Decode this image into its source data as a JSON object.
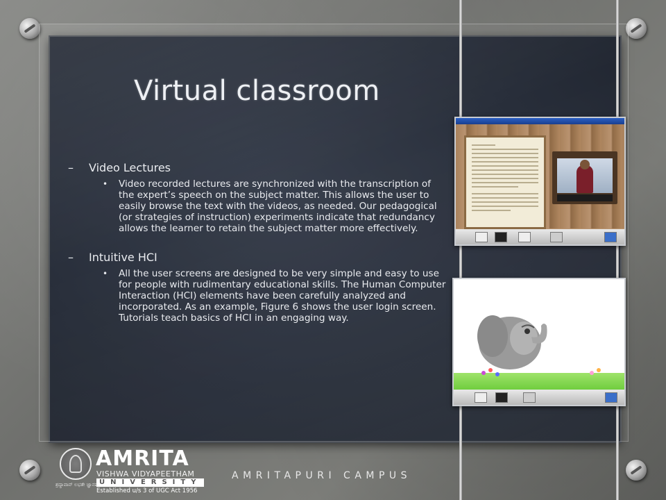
{
  "slide": {
    "title": "Virtual classroom",
    "sections": [
      {
        "heading": "Video Lectures",
        "body": "Video recorded lectures are synchronized with the transcription of the expert’s speech on the subject matter. This allows the user to easily browse the text with the videos, as needed. Our pedagogical (or strategies of instruction) experiments indicate that redundancy allows the learner to retain the subject matter more effectively."
      },
      {
        "heading": "Intuitive HCI",
        "body": "All the user screens are designed to be very simple and easy to use for people with rudimentary educational skills. The Human Computer Interaction (HCI) elements have been carefully analyzed and incorporated. As an example, Figure 6 shows the user login screen. Tutorials teach basics of HCI in an engaging way."
      }
    ]
  },
  "footer": {
    "brand": "AMRITA",
    "brand_sub": "VISHWA VIDYAPEETHAM",
    "brand_univ": "UNIVERSITY",
    "brand_est": "Established u/s 3 of UGC Act 1956",
    "emblem_caption": "ಶ್ರದ್ಧಾವಾನ್ ಲಭತೇ ಜ್ಞಾನಮ್",
    "campus": "AMRITAPURI CAMPUS"
  },
  "colors": {
    "board": "#242a36",
    "text": "#e9ebef",
    "wall": "#7d7e7a"
  },
  "icons": {
    "bolts": "screw-bolt-icon",
    "emblem": "university-emblem-icon"
  }
}
